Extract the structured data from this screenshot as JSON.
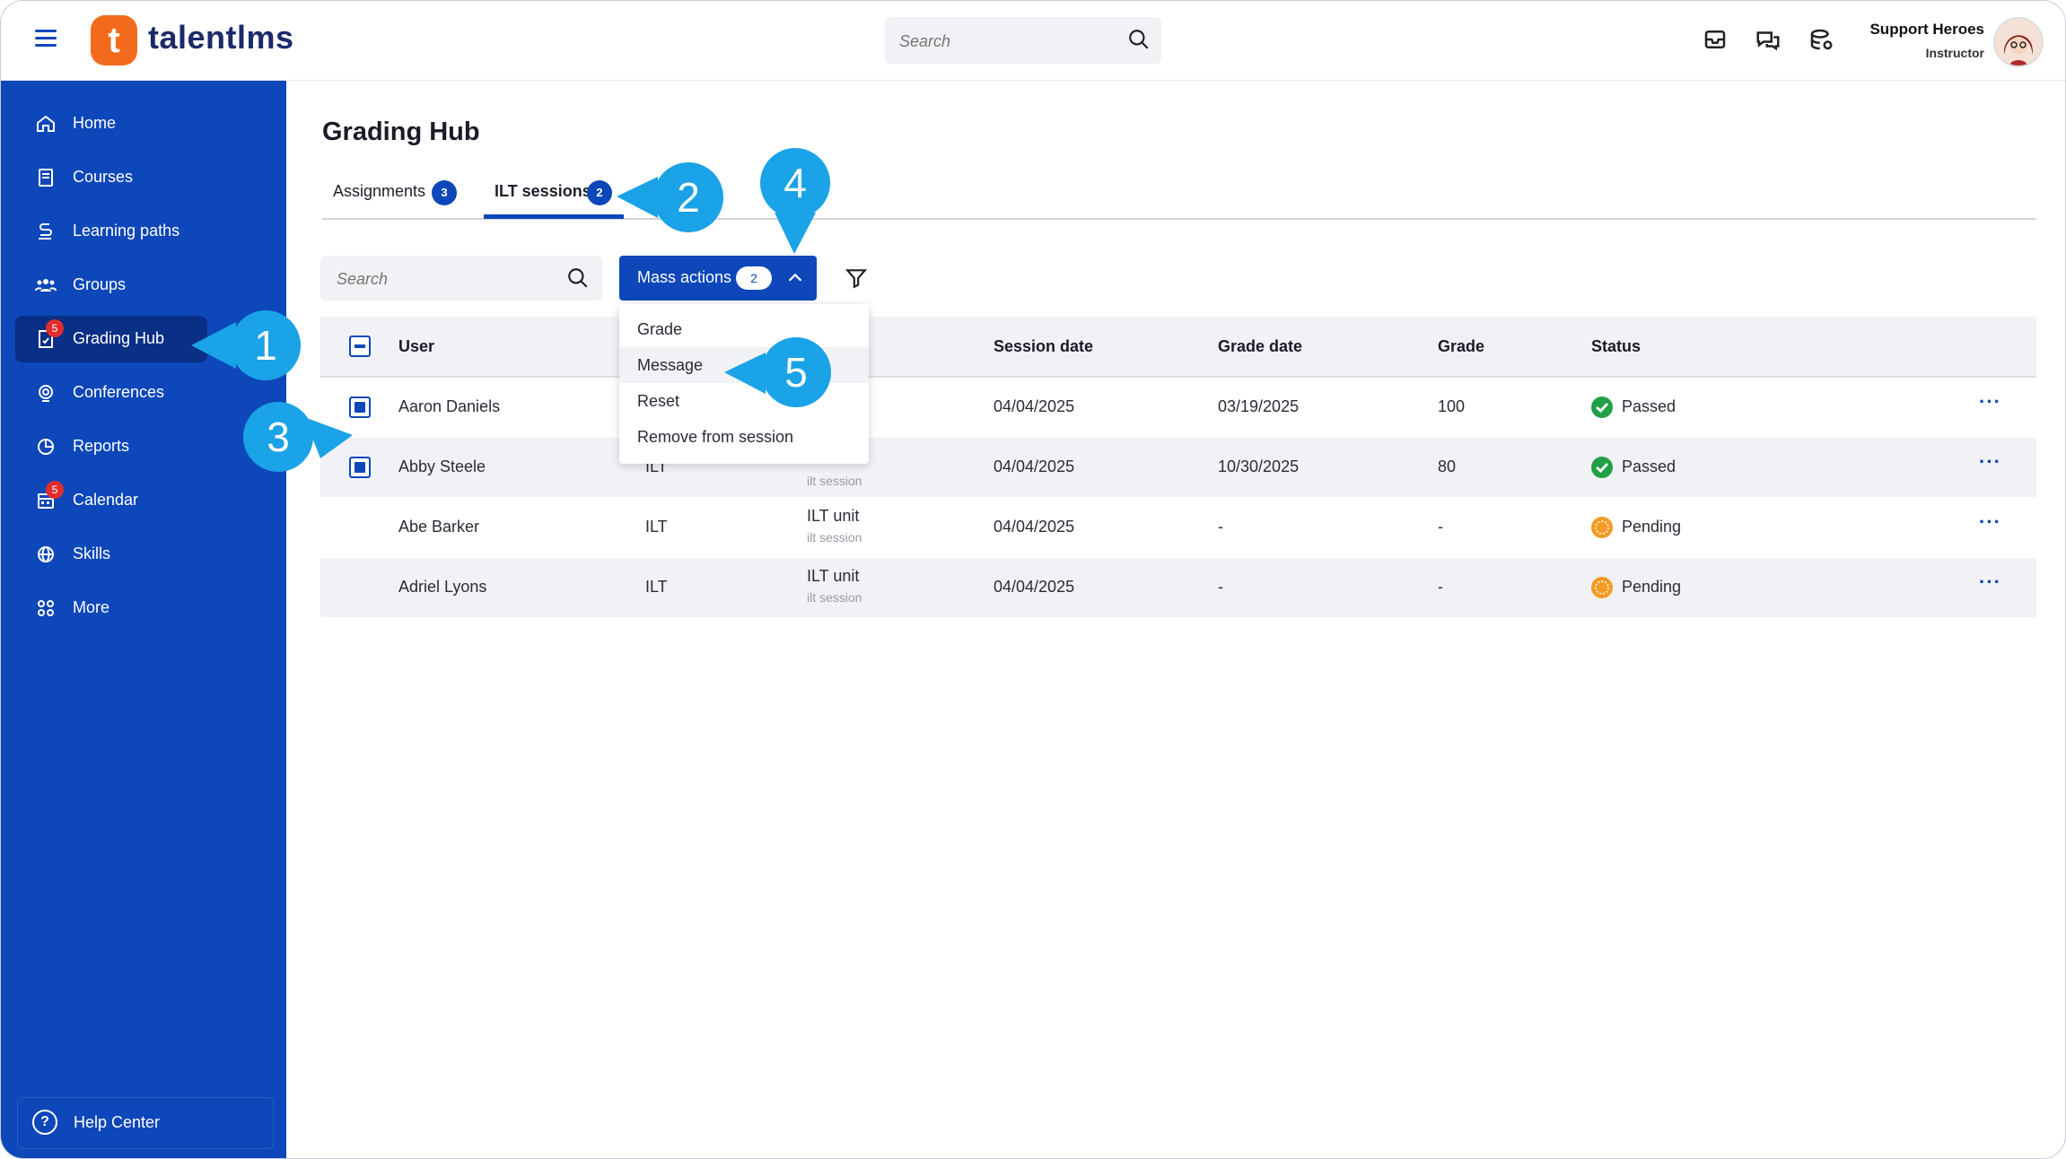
{
  "app": {
    "logo_letter": "t",
    "logo_text": "talentlms"
  },
  "topbar": {
    "search_placeholder": "Search",
    "user_name": "Support Heroes",
    "user_role": "Instructor"
  },
  "sidebar": {
    "items": [
      {
        "label": "Home",
        "icon": "home-icon"
      },
      {
        "label": "Courses",
        "icon": "book-icon"
      },
      {
        "label": "Learning paths",
        "icon": "path-icon"
      },
      {
        "label": "Groups",
        "icon": "groups-icon"
      },
      {
        "label": "Grading Hub",
        "icon": "grading-icon",
        "badge": "5",
        "active": true
      },
      {
        "label": "Conferences",
        "icon": "conference-icon"
      },
      {
        "label": "Reports",
        "icon": "pie-chart-icon"
      },
      {
        "label": "Calendar",
        "icon": "calendar-icon",
        "badge": "5"
      },
      {
        "label": "Skills",
        "icon": "globe-icon"
      },
      {
        "label": "More",
        "icon": "grid-icon"
      }
    ],
    "help_label": "Help Center"
  },
  "main": {
    "title": "Grading Hub",
    "tabs": [
      {
        "label": "Assignments",
        "count": "3"
      },
      {
        "label": "ILT sessions",
        "count": "2",
        "active": true
      }
    ],
    "search_placeholder": "Search",
    "mass_actions": {
      "label": "Mass actions",
      "count": "2"
    },
    "dropdown": [
      "Grade",
      "Message",
      "Reset",
      "Remove from session"
    ],
    "columns": [
      "User",
      "Session date",
      "Grade date",
      "Grade",
      "Status"
    ],
    "rows": [
      {
        "user": "Aaron Daniels",
        "type": "",
        "unit": "",
        "sub": "",
        "session_date": "04/04/2025",
        "grade_date": "03/19/2025",
        "grade": "100",
        "status": "Passed",
        "checked": true
      },
      {
        "user": "Abby Steele",
        "type": "ILT",
        "unit": "",
        "sub": "ilt session",
        "session_date": "04/04/2025",
        "grade_date": "10/30/2025",
        "grade": "80",
        "status": "Passed",
        "checked": true
      },
      {
        "user": "Abe Barker",
        "type": "ILT",
        "unit": "ILT unit",
        "sub": "ilt session",
        "session_date": "04/04/2025",
        "grade_date": "-",
        "grade": "-",
        "status": "Pending",
        "checked": false
      },
      {
        "user": "Adriel Lyons",
        "type": "ILT",
        "unit": "ILT unit",
        "sub": "ilt session",
        "session_date": "04/04/2025",
        "grade_date": "-",
        "grade": "-",
        "status": "Pending",
        "checked": false
      }
    ],
    "row_menu": "···"
  },
  "callouts": [
    "1",
    "2",
    "3",
    "4",
    "5"
  ],
  "colors": {
    "primary": "#0d47b9",
    "accent": "#f26b1d",
    "callout": "#1aa3e6",
    "passed": "#21a047",
    "pending": "#f59b24",
    "badge": "#e02e2e"
  }
}
